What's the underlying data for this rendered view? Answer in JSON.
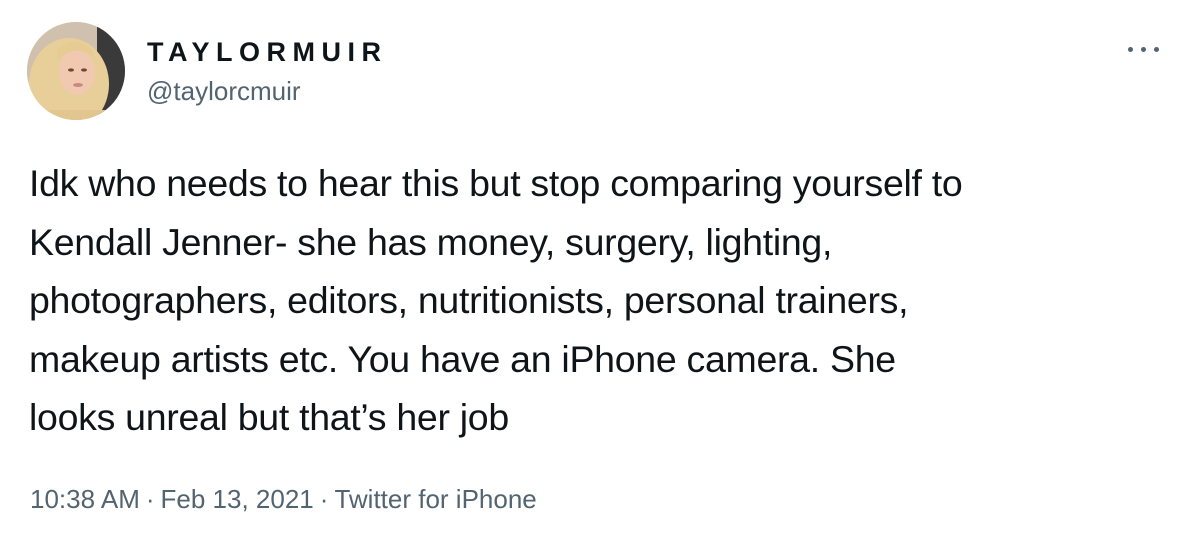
{
  "author": {
    "display_name": "TAYLORMUIR",
    "handle": "@taylorcmuir"
  },
  "tweet": {
    "text_lines": [
      "Idk who needs to hear this but stop comparing yourself to",
      "Kendall Jenner- she has money, surgery, lighting,",
      "photographers, editors, nutritionists, personal trainers,",
      "makeup artists etc. You have an iPhone camera. She",
      "looks unreal but that’s her job"
    ],
    "time": "10:38 AM",
    "date": "Feb 13, 2021",
    "separator": "·",
    "source": "Twitter for iPhone"
  },
  "icons": {
    "more": "more-horizontal-icon"
  },
  "colors": {
    "text_primary": "#0f1419",
    "text_secondary": "#536471",
    "background": "#ffffff"
  }
}
